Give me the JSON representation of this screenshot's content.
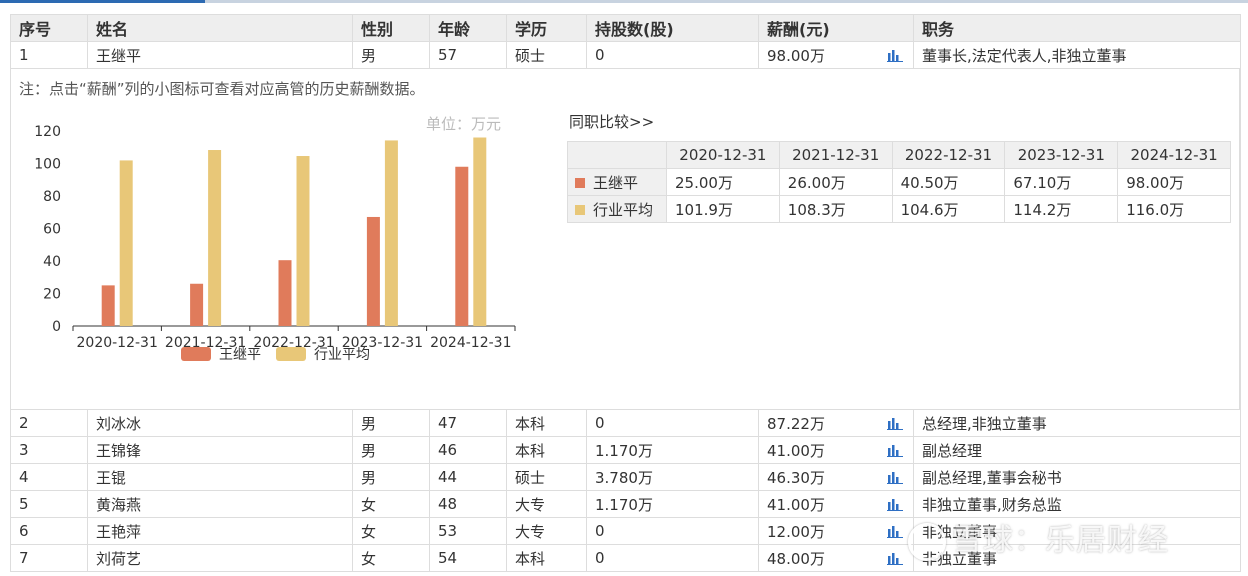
{
  "headers": [
    "序号",
    "姓名",
    "性别",
    "年龄",
    "学历",
    "持股数(股)",
    "薪酬(元)",
    "职务"
  ],
  "first_row": {
    "no": "1",
    "name": "王继平",
    "gender": "男",
    "age": "57",
    "edu": "硕士",
    "shares": "0",
    "pay": "98.00万",
    "role": "董事长,法定代表人,非独立董事"
  },
  "note": "注：点击“薪酬”列的小图标可查看对应高管的历史薪酬数据。",
  "unit_label": "单位：万元",
  "compare_title": "同职比较>>",
  "compare": {
    "dates": [
      "2020-12-31",
      "2021-12-31",
      "2022-12-31",
      "2023-12-31",
      "2024-12-31"
    ],
    "rows": [
      {
        "label": "王继平",
        "values": [
          "25.00万",
          "26.00万",
          "40.50万",
          "67.10万",
          "98.00万"
        ]
      },
      {
        "label": "行业平均",
        "values": [
          "101.9万",
          "108.3万",
          "104.6万",
          "114.2万",
          "116.0万"
        ]
      }
    ]
  },
  "rows": [
    {
      "no": "2",
      "name": "刘冰冰",
      "gender": "男",
      "age": "47",
      "edu": "本科",
      "shares": "0",
      "pay": "87.22万",
      "role": "总经理,非独立董事"
    },
    {
      "no": "3",
      "name": "王锦锋",
      "gender": "男",
      "age": "46",
      "edu": "本科",
      "shares": "1.170万",
      "pay": "41.00万",
      "role": "副总经理"
    },
    {
      "no": "4",
      "name": "王锟",
      "gender": "男",
      "age": "44",
      "edu": "硕士",
      "shares": "3.780万",
      "pay": "46.30万",
      "role": "副总经理,董事会秘书"
    },
    {
      "no": "5",
      "name": "黄海燕",
      "gender": "女",
      "age": "48",
      "edu": "大专",
      "shares": "1.170万",
      "pay": "41.00万",
      "role": "非独立董事,财务总监"
    },
    {
      "no": "6",
      "name": "王艳萍",
      "gender": "女",
      "age": "53",
      "edu": "大专",
      "shares": "0",
      "pay": "12.00万",
      "role": "非独立董事"
    },
    {
      "no": "7",
      "name": "刘荷艺",
      "gender": "女",
      "age": "54",
      "edu": "本科",
      "shares": "0",
      "pay": "48.00万",
      "role": "非独立董事"
    }
  ],
  "watermark": "雪球：乐居财经",
  "colors": {
    "person": "#e07b5b",
    "average": "#e8c778",
    "header_bg": "#eeeeee",
    "icon": "#2e6fc4"
  },
  "chart_data": {
    "type": "bar",
    "categories": [
      "2020-12-31",
      "2021-12-31",
      "2022-12-31",
      "2023-12-31",
      "2024-12-31"
    ],
    "series": [
      {
        "name": "王继平",
        "values": [
          25.0,
          26.0,
          40.5,
          67.1,
          98.0
        ]
      },
      {
        "name": "行业平均",
        "values": [
          101.9,
          108.3,
          104.6,
          114.2,
          116.0
        ]
      }
    ],
    "yticks": [
      0,
      20,
      40,
      60,
      80,
      100,
      120
    ],
    "ylim": [
      0,
      120
    ],
    "legend": "bottom"
  }
}
